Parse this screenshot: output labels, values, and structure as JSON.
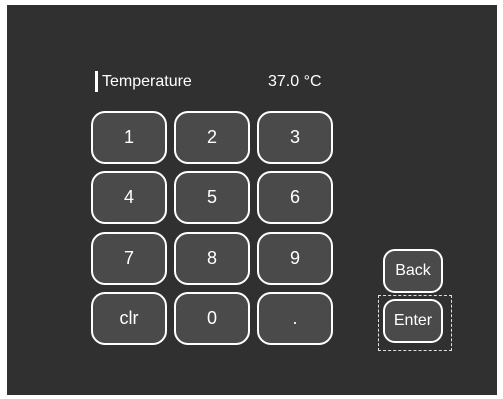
{
  "field": {
    "label": "Temperature",
    "value": "37.0 °C"
  },
  "keypad": {
    "keys": [
      "1",
      "2",
      "3",
      "4",
      "5",
      "6",
      "7",
      "8",
      "9",
      "clr",
      "0",
      "."
    ]
  },
  "actions": {
    "back_label": "Back",
    "enter_label": "Enter"
  },
  "colors": {
    "background": "#303030",
    "key_fill": "#4a4a4a",
    "key_border": "#ffffff",
    "text": "#ffffff"
  }
}
